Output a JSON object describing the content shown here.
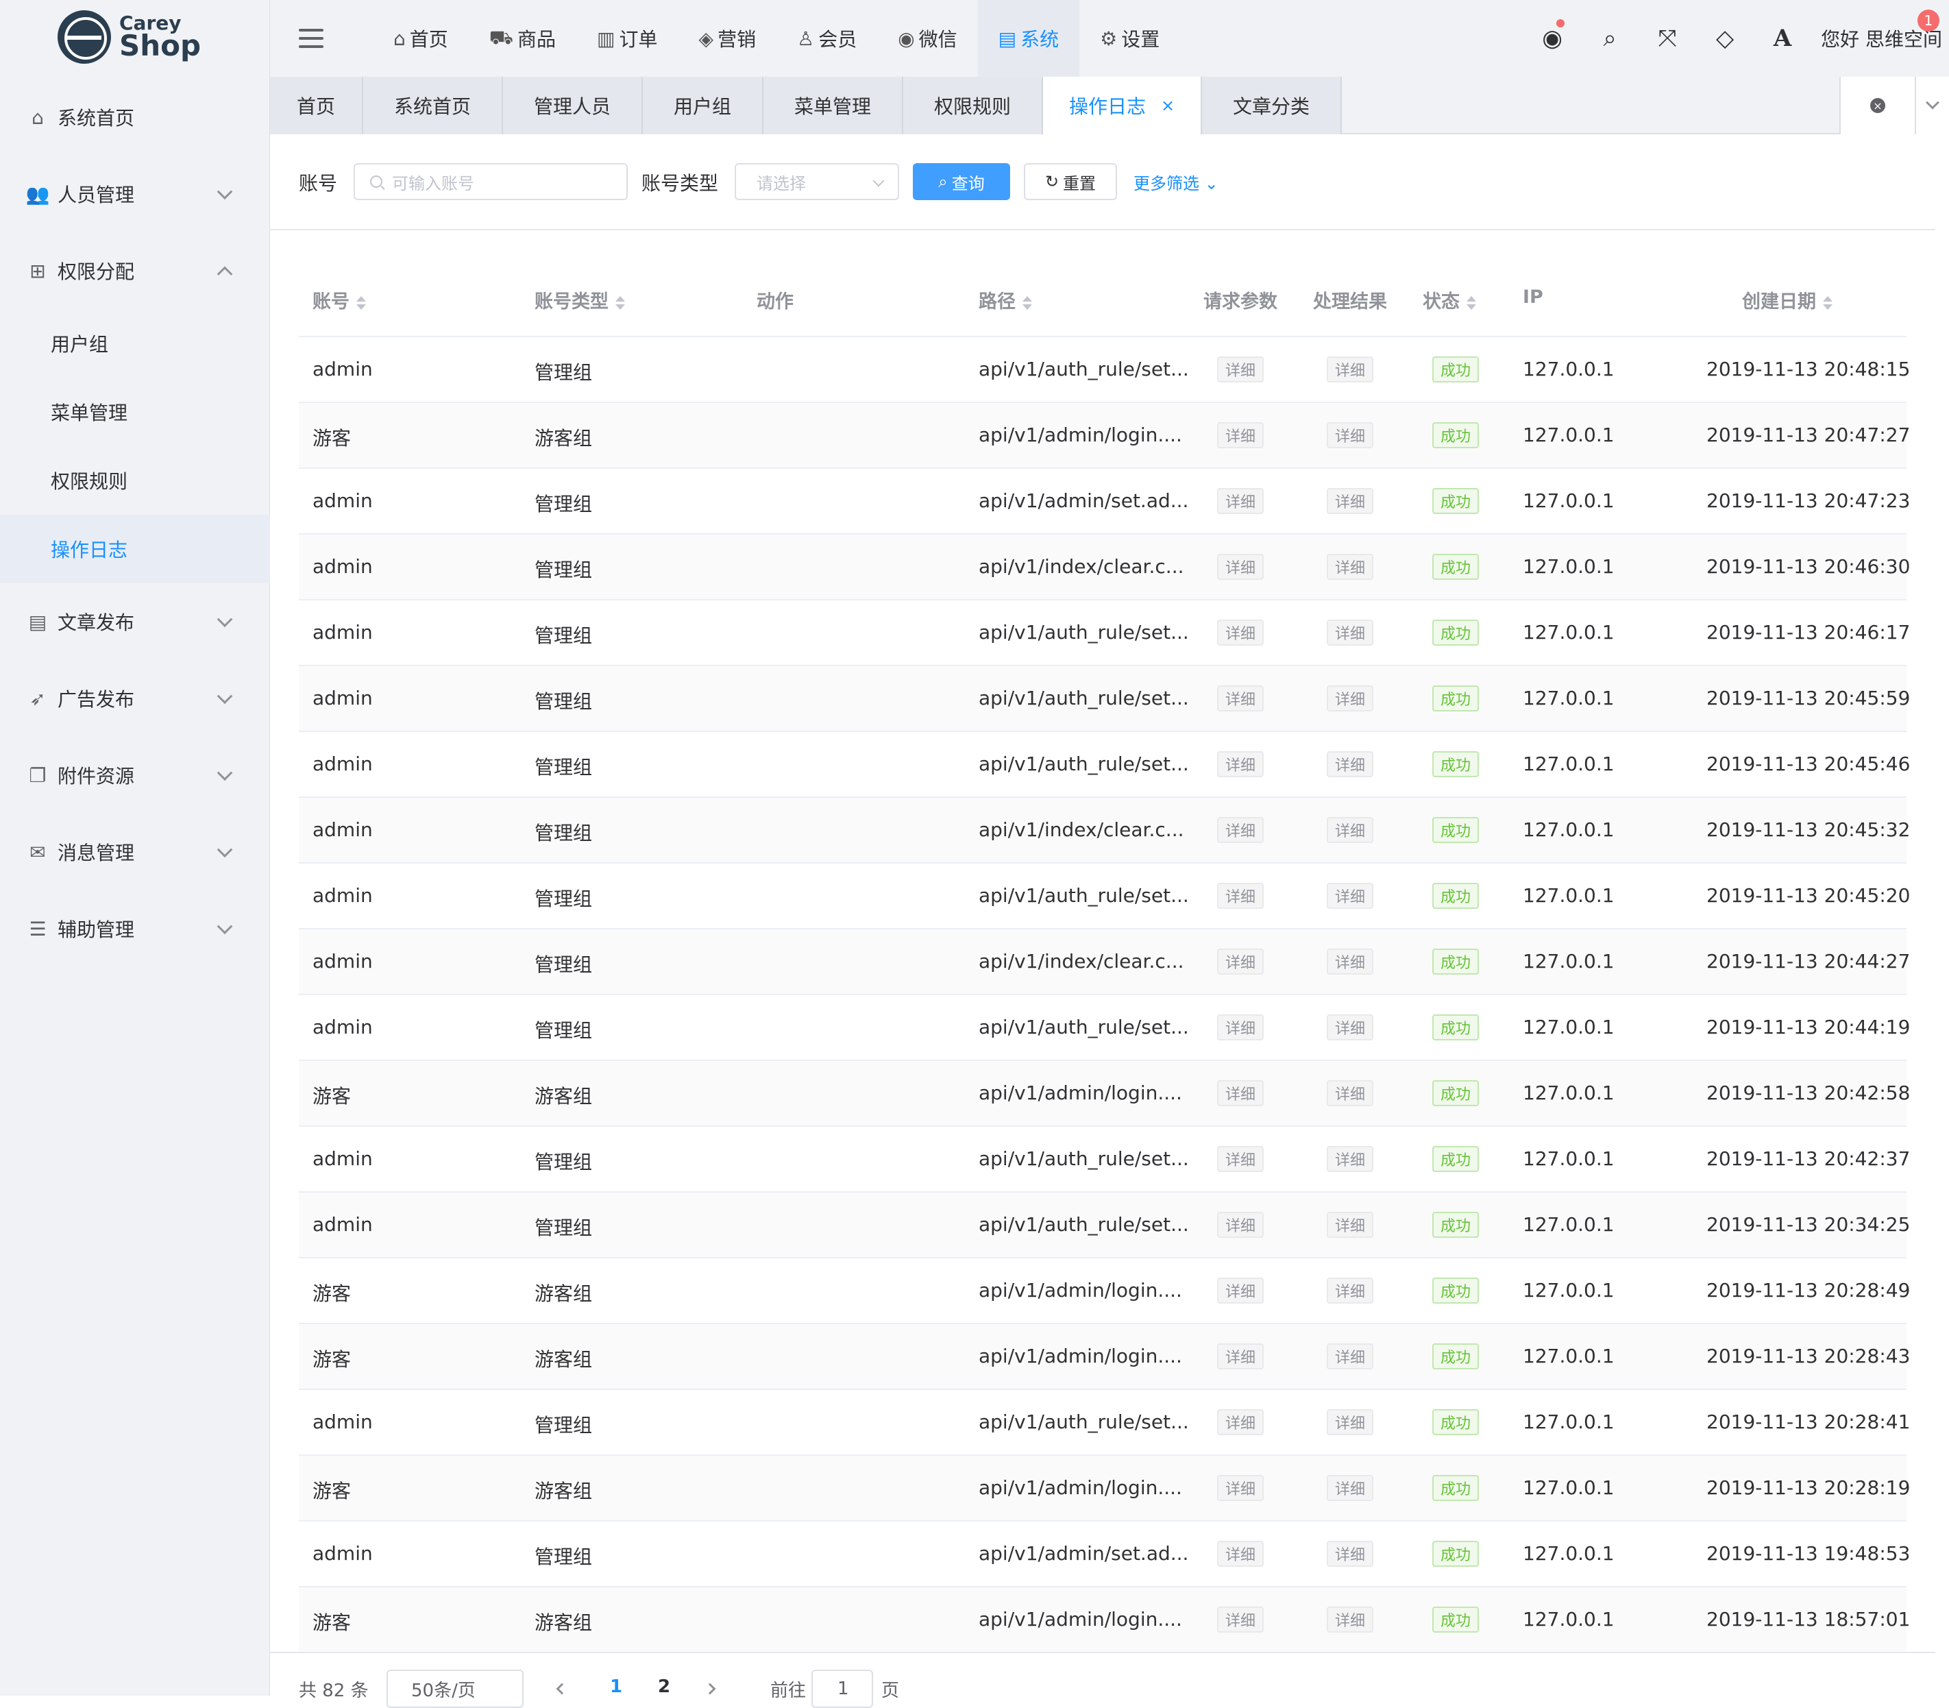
{
  "logo": {
    "line1": "Carey",
    "line2": "Shop"
  },
  "sidebar": {
    "items": [
      {
        "label": "系统首页",
        "icon": "home-icon"
      },
      {
        "label": "人员管理",
        "icon": "users-icon"
      },
      {
        "label": "权限分配",
        "icon": "sitemap-icon"
      },
      {
        "label": "文章发布",
        "icon": "newspaper-icon"
      },
      {
        "label": "广告发布",
        "icon": "rocket-icon"
      },
      {
        "label": "附件资源",
        "icon": "copy-icon"
      },
      {
        "label": "消息管理",
        "icon": "envelope-icon"
      },
      {
        "label": "辅助管理",
        "icon": "sliders-icon"
      }
    ],
    "sub_items": [
      "用户组",
      "菜单管理",
      "权限规则",
      "操作日志"
    ]
  },
  "topnav": {
    "items": [
      {
        "label": "首页",
        "icon": "home-icon"
      },
      {
        "label": "商品",
        "icon": "cart-icon"
      },
      {
        "label": "订单",
        "icon": "barcode-icon"
      },
      {
        "label": "营销",
        "icon": "tags-icon"
      },
      {
        "label": "会员",
        "icon": "user-icon"
      },
      {
        "label": "微信",
        "icon": "wechat-icon"
      },
      {
        "label": "系统",
        "icon": "server-icon"
      },
      {
        "label": "设置",
        "icon": "gears-icon"
      }
    ],
    "greeting": "您好 思维空间",
    "badge": "1"
  },
  "tabs": [
    "首页",
    "系统首页",
    "管理人员",
    "用户组",
    "菜单管理",
    "权限规则",
    "操作日志",
    "文章分类"
  ],
  "filter": {
    "account_label": "账号",
    "account_placeholder": "可输入账号",
    "type_label": "账号类型",
    "type_placeholder": "请选择",
    "query": "查询",
    "reset": "重置",
    "more": "更多筛选"
  },
  "table": {
    "headers": [
      "账号",
      "账号类型",
      "动作",
      "路径",
      "请求参数",
      "处理结果",
      "状态",
      "IP",
      "创建日期"
    ],
    "detail_label": "详细",
    "rows": [
      {
        "account": "admin",
        "type": "管理组",
        "path": "api/v1/auth_rule/set...",
        "status": "成功",
        "ip": "127.0.0.1",
        "date": "2019-11-13 20:48:15"
      },
      {
        "account": "游客",
        "type": "游客组",
        "path": "api/v1/admin/login....",
        "status": "成功",
        "ip": "127.0.0.1",
        "date": "2019-11-13 20:47:27"
      },
      {
        "account": "admin",
        "type": "管理组",
        "path": "api/v1/admin/set.ad...",
        "status": "成功",
        "ip": "127.0.0.1",
        "date": "2019-11-13 20:47:23"
      },
      {
        "account": "admin",
        "type": "管理组",
        "path": "api/v1/index/clear.c...",
        "status": "成功",
        "ip": "127.0.0.1",
        "date": "2019-11-13 20:46:30"
      },
      {
        "account": "admin",
        "type": "管理组",
        "path": "api/v1/auth_rule/set...",
        "status": "成功",
        "ip": "127.0.0.1",
        "date": "2019-11-13 20:46:17"
      },
      {
        "account": "admin",
        "type": "管理组",
        "path": "api/v1/auth_rule/set...",
        "status": "成功",
        "ip": "127.0.0.1",
        "date": "2019-11-13 20:45:59"
      },
      {
        "account": "admin",
        "type": "管理组",
        "path": "api/v1/auth_rule/set...",
        "status": "成功",
        "ip": "127.0.0.1",
        "date": "2019-11-13 20:45:46"
      },
      {
        "account": "admin",
        "type": "管理组",
        "path": "api/v1/index/clear.c...",
        "status": "成功",
        "ip": "127.0.0.1",
        "date": "2019-11-13 20:45:32"
      },
      {
        "account": "admin",
        "type": "管理组",
        "path": "api/v1/auth_rule/set...",
        "status": "成功",
        "ip": "127.0.0.1",
        "date": "2019-11-13 20:45:20"
      },
      {
        "account": "admin",
        "type": "管理组",
        "path": "api/v1/index/clear.c...",
        "status": "成功",
        "ip": "127.0.0.1",
        "date": "2019-11-13 20:44:27"
      },
      {
        "account": "admin",
        "type": "管理组",
        "path": "api/v1/auth_rule/set...",
        "status": "成功",
        "ip": "127.0.0.1",
        "date": "2019-11-13 20:44:19"
      },
      {
        "account": "游客",
        "type": "游客组",
        "path": "api/v1/admin/login....",
        "status": "成功",
        "ip": "127.0.0.1",
        "date": "2019-11-13 20:42:58"
      },
      {
        "account": "admin",
        "type": "管理组",
        "path": "api/v1/auth_rule/set...",
        "status": "成功",
        "ip": "127.0.0.1",
        "date": "2019-11-13 20:42:37"
      },
      {
        "account": "admin",
        "type": "管理组",
        "path": "api/v1/auth_rule/set...",
        "status": "成功",
        "ip": "127.0.0.1",
        "date": "2019-11-13 20:34:25"
      },
      {
        "account": "游客",
        "type": "游客组",
        "path": "api/v1/admin/login....",
        "status": "成功",
        "ip": "127.0.0.1",
        "date": "2019-11-13 20:28:49"
      },
      {
        "account": "游客",
        "type": "游客组",
        "path": "api/v1/admin/login....",
        "status": "成功",
        "ip": "127.0.0.1",
        "date": "2019-11-13 20:28:43"
      },
      {
        "account": "admin",
        "type": "管理组",
        "path": "api/v1/auth_rule/set...",
        "status": "成功",
        "ip": "127.0.0.1",
        "date": "2019-11-13 20:28:41"
      },
      {
        "account": "游客",
        "type": "游客组",
        "path": "api/v1/admin/login....",
        "status": "成功",
        "ip": "127.0.0.1",
        "date": "2019-11-13 20:28:19"
      },
      {
        "account": "admin",
        "type": "管理组",
        "path": "api/v1/admin/set.ad...",
        "status": "成功",
        "ip": "127.0.0.1",
        "date": "2019-11-13 19:48:53"
      },
      {
        "account": "游客",
        "type": "游客组",
        "path": "api/v1/admin/login....",
        "status": "成功",
        "ip": "127.0.0.1",
        "date": "2019-11-13 18:57:01"
      }
    ]
  },
  "pagination": {
    "total": "共 82 条",
    "page_size": "50条/页",
    "pages": [
      "1",
      "2"
    ],
    "goto_label": "前往",
    "goto_value": "1",
    "page_suffix": "页"
  },
  "colors": {
    "accent": "#1890ff",
    "primary_button": "#409eff",
    "success": "#67c23a",
    "danger": "#f56c6c",
    "sidebar_bg": "#f0f2f5"
  }
}
